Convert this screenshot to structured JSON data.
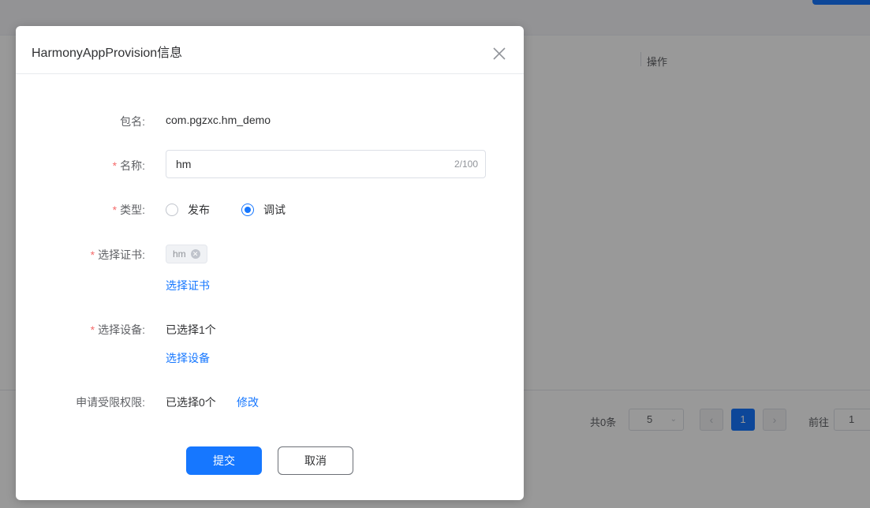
{
  "background": {
    "table": {
      "column_operation": "操作"
    },
    "pagination": {
      "total": "共0条",
      "page_size": "5",
      "prev": "‹",
      "current_page": "1",
      "next": "›",
      "goto_label": "前往",
      "goto_value": "1"
    }
  },
  "dialog": {
    "title": "HarmonyAppProvision信息",
    "fields": {
      "package": {
        "label": "包名:",
        "value": "com.pgzxc.hm_demo"
      },
      "name": {
        "label": "名称:",
        "value": "hm",
        "counter": "2/100",
        "required": true
      },
      "type": {
        "label": "类型:",
        "required": true,
        "options": [
          {
            "label": "发布",
            "checked": false
          },
          {
            "label": "调试",
            "checked": true
          }
        ]
      },
      "certificate": {
        "label": "选择证书:",
        "required": true,
        "tag": "hm",
        "link": "选择证书"
      },
      "device": {
        "label": "选择设备:",
        "required": true,
        "value": "已选择1个",
        "link": "选择设备"
      },
      "permissions": {
        "label": "申请受限权限:",
        "value": "已选择0个",
        "link": "修改"
      }
    },
    "buttons": {
      "submit": "提交",
      "cancel": "取消"
    }
  },
  "required_mark": "*",
  "colors": {
    "primary": "#1677ff",
    "required": "#f56c6c"
  },
  "icons": {
    "close": "close-icon",
    "tag_remove": "tag-close-icon",
    "select_arrow": "chevron-down-icon"
  }
}
